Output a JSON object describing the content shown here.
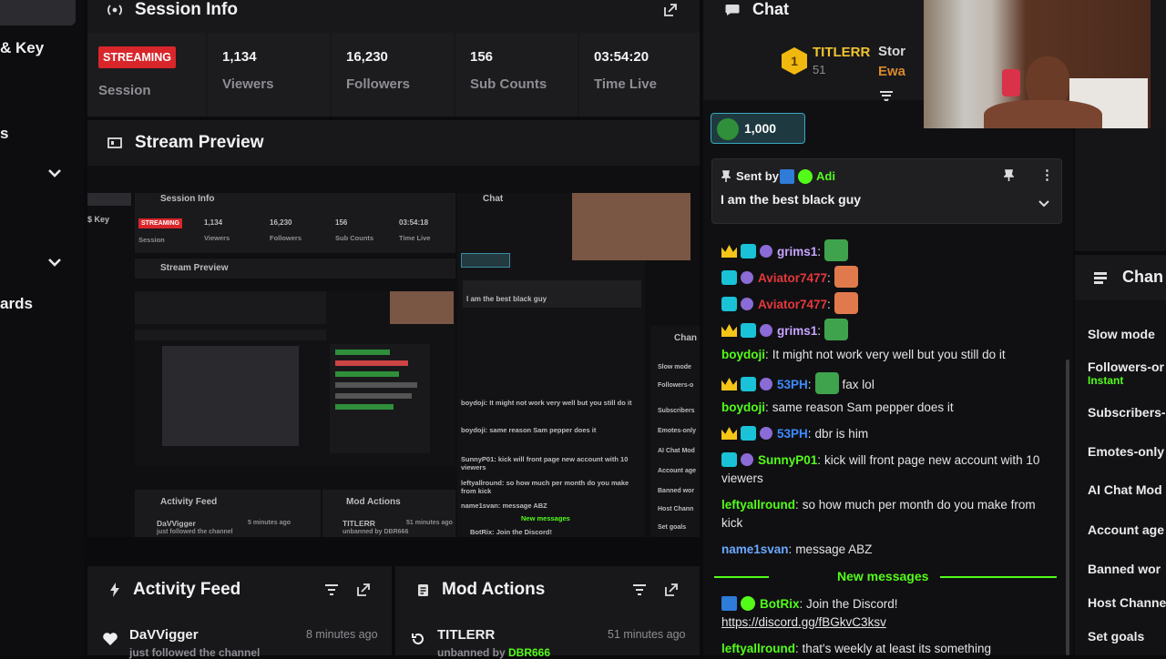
{
  "sidebar": {
    "items": [
      "& Key",
      "s",
      "ards"
    ]
  },
  "session": {
    "title": "Session Info",
    "badge": "STREAMING",
    "badge_label": "Session",
    "stats": [
      {
        "value": "1,134",
        "label": "Viewers"
      },
      {
        "value": "16,230",
        "label": "Followers"
      },
      {
        "value": "156",
        "label": "Sub Counts"
      },
      {
        "value": "03:54:20",
        "label": "Time Live"
      }
    ]
  },
  "preview": {
    "title": "Stream Preview",
    "mini_session_title": "Session Info",
    "mini_chat_title": "Chat",
    "mini_stats": [
      {
        "value": "1,134",
        "label": "Viewers"
      },
      {
        "value": "16,230",
        "label": "Followers"
      },
      {
        "value": "156",
        "label": "Sub Counts"
      },
      {
        "value": "03:54:18",
        "label": "Time Live"
      }
    ],
    "mini_badge": "STREAMING",
    "mini_badge_label": "Session",
    "mini_preview_title": "Stream Preview",
    "mini_activity": "Activity Feed",
    "mini_mod": "Mod Actions",
    "mini_user": "DaVVigger",
    "mini_user_sub": "just followed the channel",
    "mini_time1": "5 minutes ago",
    "mini_mod_user": "TITLERR",
    "mini_mod_sub": "unbanned by DBR666",
    "mini_time2": "51 minutes ago",
    "mini_pinned": "I am the best black guy",
    "mini_newmsg": "New messages",
    "mini_botrix": "BotRix: Join the Discord!",
    "mini_channel": "Chan",
    "mini_settings": [
      "Slow mode",
      "Followers-o",
      "Subscribers",
      "Emotes-only",
      "AI Chat Mod",
      "Account age",
      "Banned wor",
      "Host Chann",
      "Set goals"
    ],
    "mini_chat_lines": [
      "boydoji: It might not work very well but you still do it",
      "boydoji: same reason Sam pepper does it",
      "SunnyP01: kick will front page new account with 10 viewers",
      "leftyallround: so how much per month do you make from kick",
      "name1svan: message ABZ"
    ]
  },
  "activity": {
    "title": "Activity Feed",
    "user": "DaVVigger",
    "sub": "just followed the channel",
    "time": "8 minutes ago"
  },
  "mod": {
    "title": "Mod Actions",
    "user": "TITLERR",
    "sub_prefix": "unbanned by ",
    "sub_user": "DBR666",
    "time": "51 minutes ago"
  },
  "chat": {
    "title": "Chat",
    "leader_name": "TITLERR",
    "leader_rank": "1",
    "leader_count": "51",
    "leader2": "Stor",
    "leader3": "Ewa",
    "balance": "1,000",
    "pinned_sent_by": "Sent by",
    "pinned_user": "Adi",
    "pinned_message": "I am the best black guy",
    "new_messages": "New messages",
    "messages": [
      {
        "user": "grims1",
        "text": "",
        "color": "#c7a4ff",
        "badges": [
          "crown",
          "og",
          "av"
        ],
        "emote": "#3fa34d"
      },
      {
        "user": "Aviator7477",
        "text": "",
        "color": "#e5383b",
        "badges": [
          "og",
          "av"
        ],
        "emote": "#e07a4c"
      },
      {
        "user": "Aviator7477",
        "text": "",
        "color": "#e5383b",
        "badges": [
          "og",
          "av"
        ],
        "emote": "#e07a4c"
      },
      {
        "user": "grims1",
        "text": "",
        "color": "#c7a4ff",
        "badges": [
          "crown",
          "og",
          "av"
        ],
        "emote": "#3fa34d"
      },
      {
        "user": "boydoji",
        "text": "It might not work very well but you still do it",
        "color": "#53fc18",
        "badges": []
      },
      {
        "user": "53PH",
        "text": "fax lol",
        "color": "#3d8bff",
        "badges": [
          "crown",
          "og",
          "av"
        ],
        "emote": "#3fa34d"
      },
      {
        "user": "boydoji",
        "text": "same reason Sam pepper does it",
        "color": "#53fc18",
        "badges": []
      },
      {
        "user": "53PH",
        "text": "dbr is him",
        "color": "#3d8bff",
        "badges": [
          "crown",
          "og",
          "av"
        ]
      },
      {
        "user": "SunnyP01",
        "text": "kick will front page new account with 10 viewers",
        "color": "#53fc18",
        "badges": [
          "og",
          "av"
        ]
      },
      {
        "user": "leftyallround",
        "text": "so how much per month do you make from kick",
        "color": "#53fc18",
        "badges": []
      },
      {
        "user": "name1svan",
        "text": "message ABZ",
        "color": "#6aa9ff",
        "badges": []
      }
    ],
    "bot_user": "BotRix",
    "bot_text": "Join the Discord!",
    "bot_link": "https://discord.gg/fBGkvC3ksv",
    "last_user": "leftyallround",
    "last_text": "that's weekly at least its something"
  },
  "settings": {
    "title": "Chan",
    "items": [
      "Slow mode",
      "Followers-or",
      "Subscribers-",
      "Emotes-only",
      "AI Chat Mod",
      "Account age",
      "Banned wor",
      "Host Channe",
      "Set goals"
    ],
    "followers_sub": "Instant"
  },
  "colors": {
    "accent": "#53fc18",
    "streaming_red": "#d8262b",
    "panel": "#18181b"
  }
}
